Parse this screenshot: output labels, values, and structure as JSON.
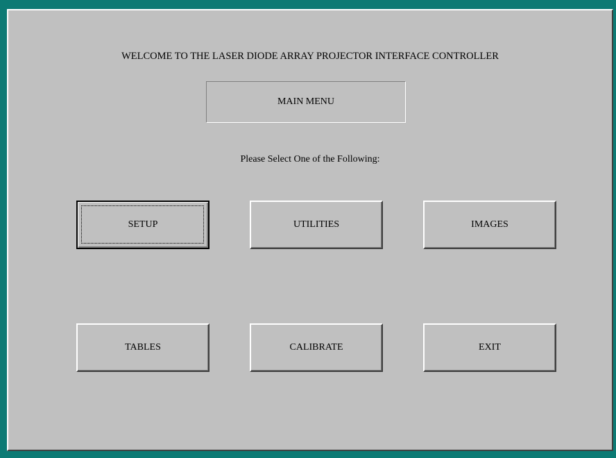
{
  "welcome_text": "WELCOME TO THE LASER DIODE ARRAY PROJECTOR INTERFACE CONTROLLER",
  "menu_title": "MAIN MENU",
  "prompt": "Please Select One of the Following:",
  "buttons": {
    "setup": "SETUP",
    "utilities": "UTILITIES",
    "images": "IMAGES",
    "tables": "TABLES",
    "calibrate": "CALIBRATE",
    "exit": "EXIT"
  },
  "focused_button": "setup",
  "colors": {
    "background": "#0c7a74",
    "panel": "#c0c0c0"
  }
}
